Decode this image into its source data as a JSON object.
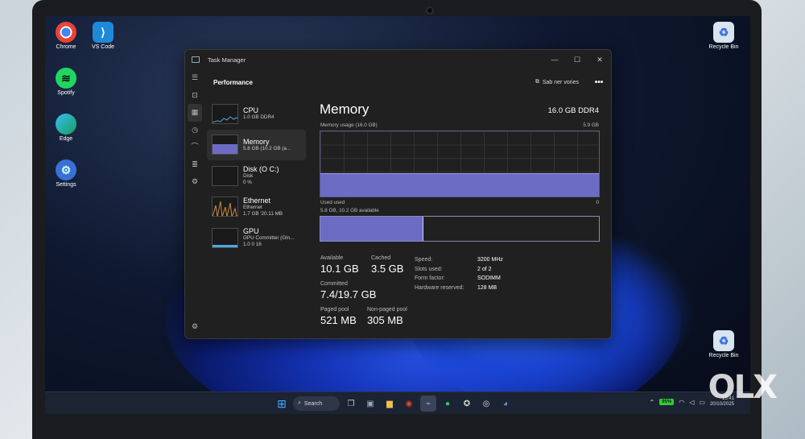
{
  "desktop": {
    "icons": [
      {
        "label": "Chrome"
      },
      {
        "label": "VS Code"
      },
      {
        "label": "Spotify"
      },
      {
        "label": "Edge"
      },
      {
        "label": "Settings"
      },
      {
        "label": "Recycle Bin"
      },
      {
        "label": "Recycle Bin"
      }
    ]
  },
  "window": {
    "title": "Task Manager",
    "header": "Performance",
    "run_task_label": "Sab ner vories",
    "more_label": "•••"
  },
  "devices": [
    {
      "name": "CPU",
      "sub": "1.0 GB DDR4"
    },
    {
      "name": "Memory",
      "sub": "5.8 GB (10.2 GB (a..."
    },
    {
      "name": "Disk (O C:)",
      "sub1": "Disk",
      "sub2": "0 %"
    },
    {
      "name": "Ethernet",
      "sub1": "Ethernet",
      "sub2": "1.7 GB '20.11 MB"
    },
    {
      "name": "GPU",
      "sub1": "GPU Committer (Gln...",
      "sub2": "1.0 0 16"
    }
  ],
  "memory": {
    "title": "Memory",
    "capacity": "16.0 GB DDR4",
    "usage_label": "Memory usage (16.0 GB)",
    "usage_max": "5.9 GB",
    "used_label": "Used used",
    "used_axis_min": "0",
    "composition_label": "5.8 GB, 10.2 GB available",
    "usage_fraction": 0.36,
    "composition_used_fraction": 0.37,
    "stats": {
      "available_label": "Available",
      "available_value": "10.1 GB",
      "cached_label": "Cached",
      "cached_value": "3.5 GB",
      "committed_label": "Committed",
      "committed_value": "7.4/19.7 GB",
      "paged_label": "Paged pool",
      "paged_value": "521 MB",
      "nonpaged_label": "Non-paged pool",
      "nonpaged_value": "305 MB"
    },
    "specs": [
      {
        "k": "Speed:",
        "v": "3200 MHz"
      },
      {
        "k": "Slots used:",
        "v": "2 of 2"
      },
      {
        "k": "Form factor:",
        "v": "SODIMM"
      },
      {
        "k": "Hardware reserved:",
        "v": "128 MB"
      }
    ]
  },
  "taskbar": {
    "search_label": "Search",
    "battery": "95%",
    "time": "15:41",
    "date": "20/10/2025"
  },
  "watermark": "OLX",
  "colors": {
    "accent": "#6c6cc4",
    "window_bg": "#202020"
  }
}
